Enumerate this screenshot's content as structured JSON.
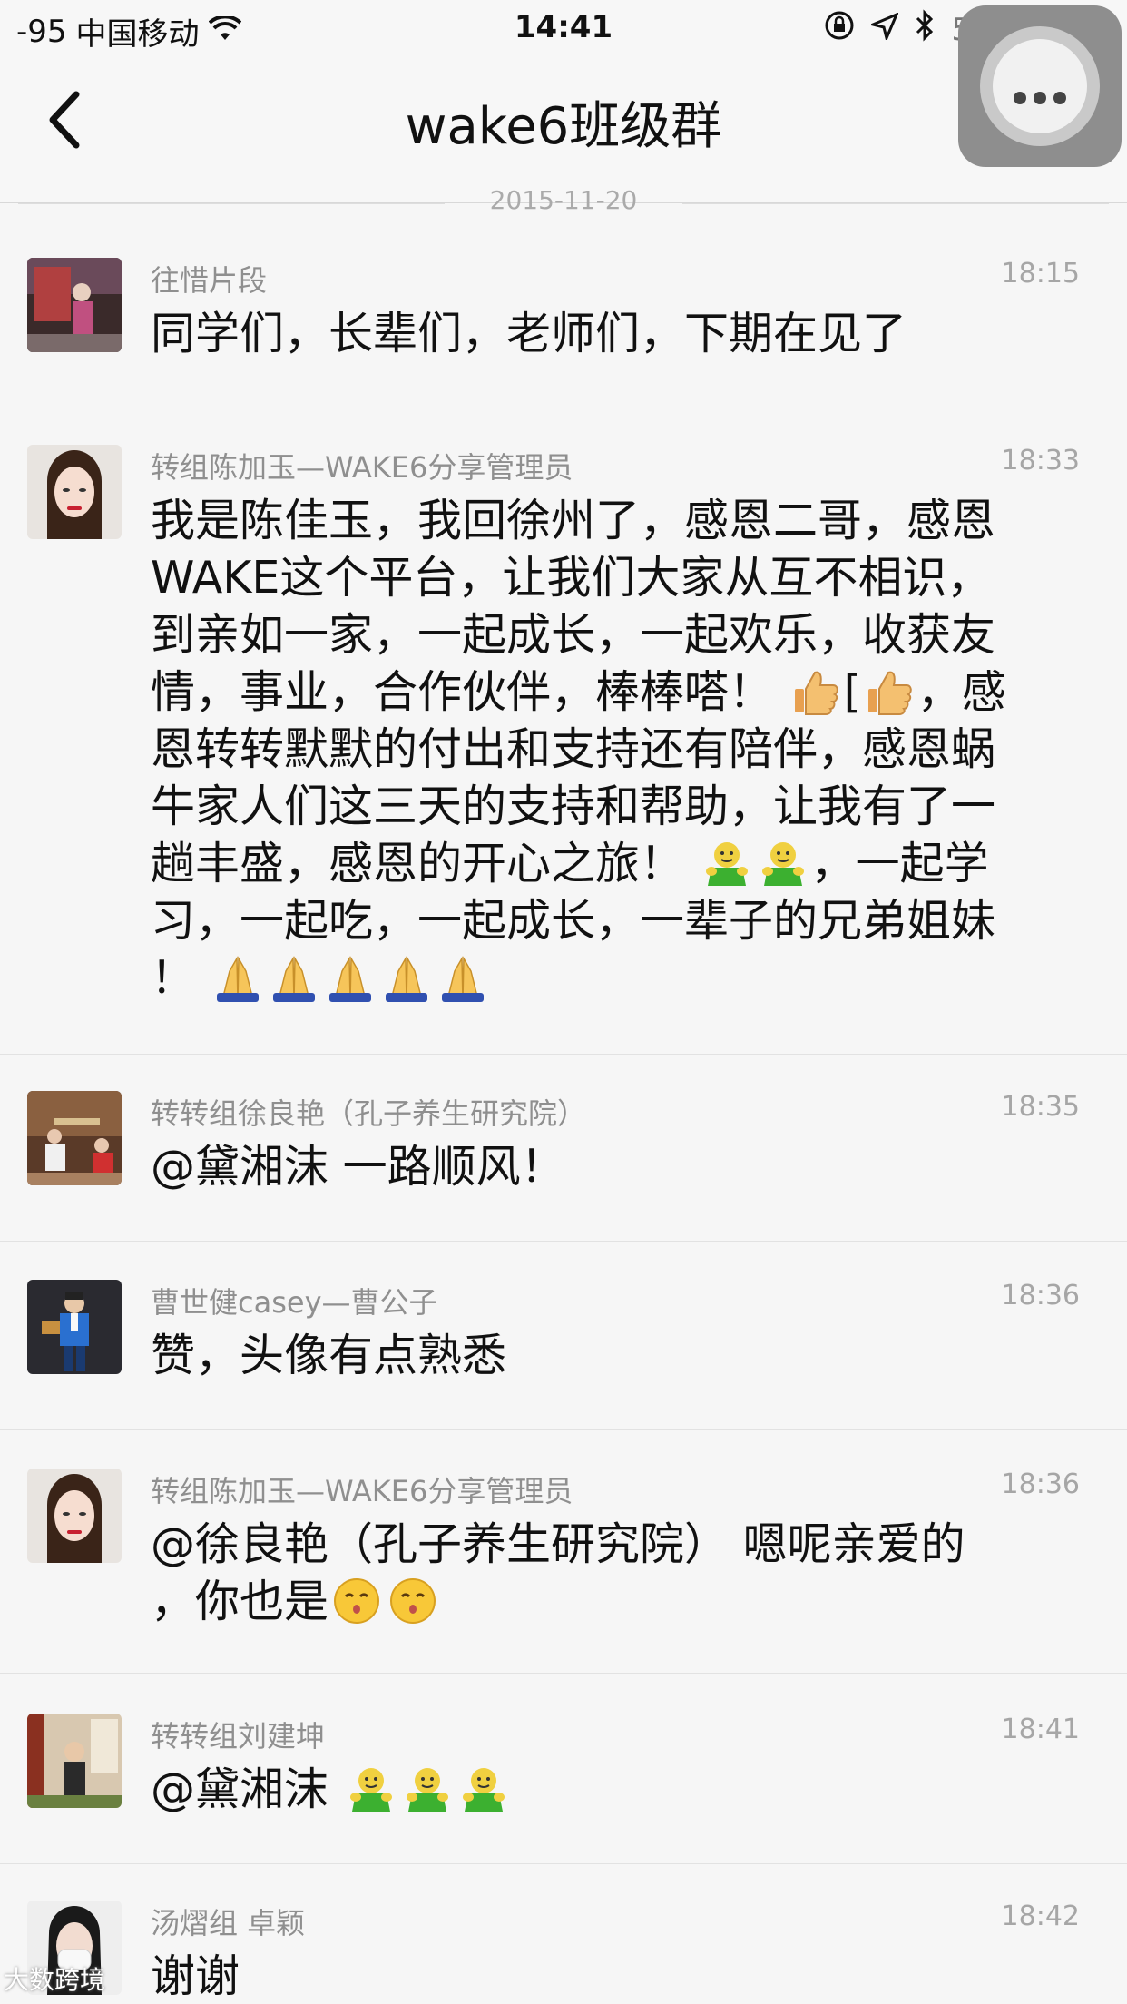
{
  "status": {
    "signal": "-95",
    "carrier": "中国移动",
    "time": "14:41",
    "battery": "52%",
    "battery_level": 0.52
  },
  "header": {
    "title": "wake6班级群"
  },
  "date": "2015-11-20",
  "messages": [
    {
      "sender": "往惜片段",
      "time": "18:15",
      "text": "同学们，长辈们，老师们，下期在见了"
    },
    {
      "sender": "转组陈加玉—WAKE6分享管理员",
      "time": "18:33",
      "text": [
        "我是陈佳玉，我回徐州了，感恩二哥，感恩",
        "WAKE这个平台，让我们大家从互不相识，",
        "到亲如一家，一起成长，一起欢乐，收获友",
        "情，事业，合作伙伴，棒棒嗒！",
        "[",
        "，感",
        "恩转转默默的付出和支持还有陪伴，感恩蜗",
        "牛家人们这三天的支持和帮助，让我有了一",
        "趟丰盛，感恩的开心之旅！",
        "，一起学",
        "习，一起吃，一起成长，一辈子的兄弟姐妹",
        "！"
      ]
    },
    {
      "sender": "转转组徐良艳（孔子养生研究院）",
      "time": "18:35",
      "text": "@黛湘沫 一路顺风！"
    },
    {
      "sender": "曹世健casey—曹公子",
      "time": "18:36",
      "text": "赞，头像有点熟悉"
    },
    {
      "sender": "转组陈加玉—WAKE6分享管理员",
      "time": "18:36",
      "text": [
        "@徐良艳（孔子养生研究院） 嗯呢亲爱的",
        "，你也是"
      ]
    },
    {
      "sender": "转转组刘建坤",
      "time": "18:41",
      "text": "@黛湘沫"
    },
    {
      "sender": "汤熠组 卓颖",
      "time": "18:42",
      "text": "谢谢"
    }
  ],
  "watermark": "大数跨境"
}
